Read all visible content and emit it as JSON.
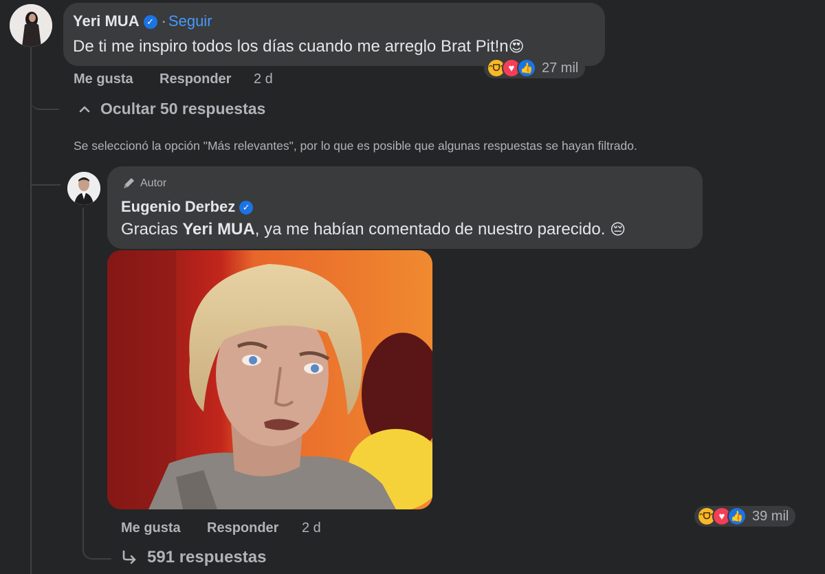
{
  "comment": {
    "author": "Yeri MUA",
    "separator": "·",
    "follow_label": "Seguir",
    "text": "De ti me inspiro todos los días cuando me arreglo Brat Pit!n",
    "emoji_trailing": "😍",
    "actions": {
      "like": "Me gusta",
      "reply": "Responder",
      "time": "2 d"
    },
    "reactions": {
      "icons": [
        "haha-icon",
        "love-icon",
        "like-icon"
      ],
      "count": "27 mil"
    }
  },
  "hide_replies": {
    "label": "Ocultar 50 respuestas"
  },
  "filter_notice": "Se seleccionó la opción \"Más relevantes\", por lo que es posible que algunas respuestas se hayan filtrado.",
  "reply": {
    "badge": "Autor",
    "author": "Eugenio Derbez",
    "text_prefix": "Gracias ",
    "mention": "Yeri MUA",
    "text_suffix": ", ya me habían comentado de nuestro parecido.",
    "emoji_trailing": "😔",
    "actions": {
      "like": "Me gusta",
      "reply": "Responder",
      "time": "2 d"
    },
    "reactions": {
      "icons": [
        "haha-icon",
        "love-icon",
        "like-icon"
      ],
      "count": "39 mil"
    },
    "replies_link": "591 respuestas"
  },
  "colors": {
    "background": "#242526",
    "bubble": "#3a3b3c",
    "link": "#4599ff",
    "verified": "#1b74e4"
  }
}
